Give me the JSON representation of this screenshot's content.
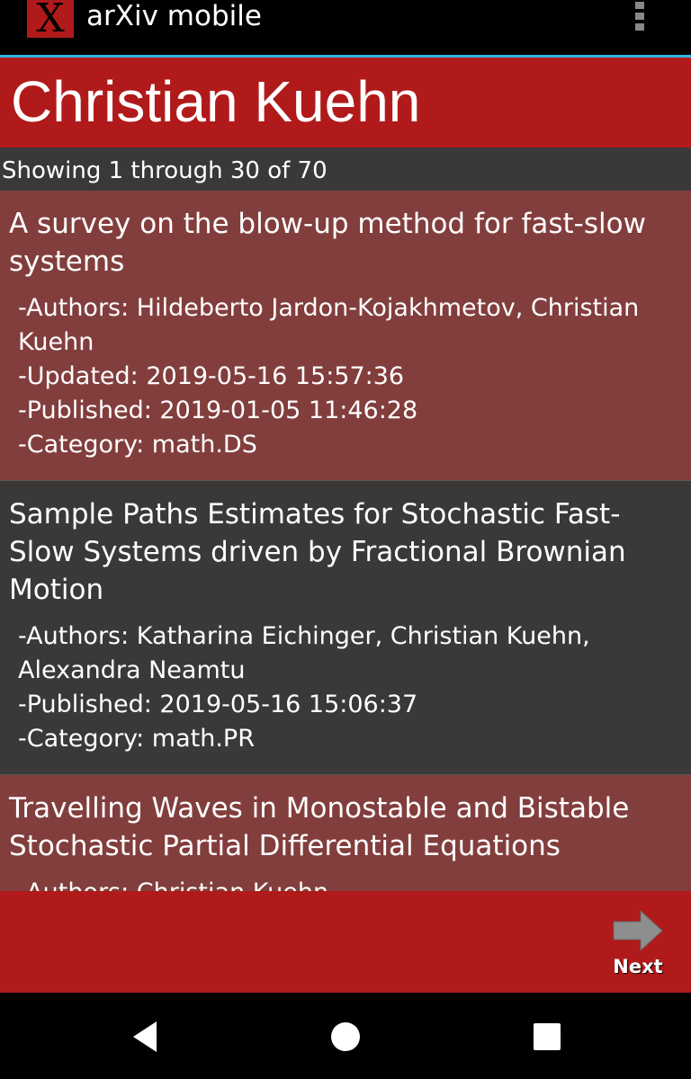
{
  "app": {
    "logo_text": "X",
    "title": "arXiv mobile"
  },
  "header": {
    "author_name": "Christian Kuehn"
  },
  "list_status": "Showing 1 through 30 of 70",
  "papers": [
    {
      "title": "A survey on the blow-up method for fast-slow systems",
      "authors": "-Authors: Hildeberto Jardon-Kojakhmetov, Christian Kuehn",
      "updated": "-Updated: 2019-05-16 15:57:36",
      "published": "-Published: 2019-01-05 11:46:28",
      "category": "-Category: math.DS"
    },
    {
      "title": "Sample Paths Estimates for Stochastic Fast-Slow Systems driven by Fractional Brownian Motion",
      "authors": "-Authors: Katharina Eichinger, Christian Kuehn, Alexandra Neamtu",
      "published": "-Published: 2019-05-16 15:06:37",
      "category": "-Category: math.PR"
    },
    {
      "title": "Travelling Waves in Monostable and Bistable Stochastic Partial Differential Equations",
      "authors": "-Authors: Christian Kuehn"
    }
  ],
  "footer": {
    "next_label": "Next"
  },
  "icons": {
    "overflow": "overflow-menu-icon",
    "next": "next-arrow-icon",
    "back": "back-icon",
    "home": "home-icon",
    "recents": "recents-icon"
  },
  "colors": {
    "brand_red": "#b11a1a",
    "item_red": "#823e3d",
    "item_dark": "#3a3938",
    "accent_blue": "#33b5e5"
  }
}
